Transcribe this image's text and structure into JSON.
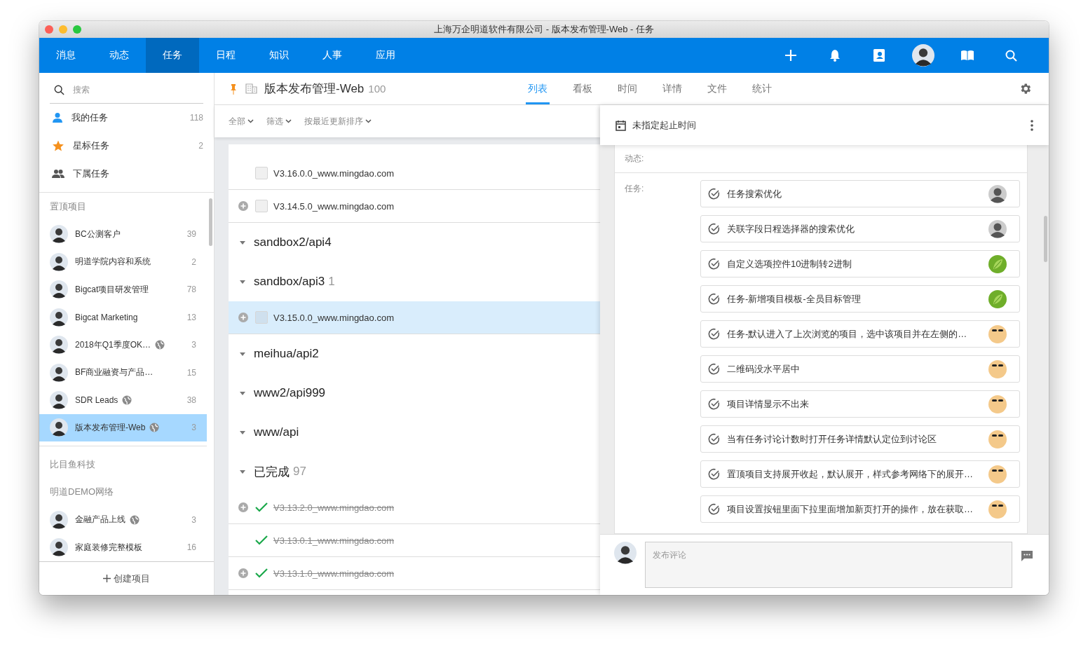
{
  "window": {
    "title": "上海万企明道软件有限公司 - 版本发布管理-Web - 任务"
  },
  "nav": {
    "tabs": [
      {
        "label": "消息",
        "selected": false
      },
      {
        "label": "动态",
        "selected": false
      },
      {
        "label": "任务",
        "selected": true
      },
      {
        "label": "日程",
        "selected": false
      },
      {
        "label": "知识",
        "selected": false
      },
      {
        "label": "人事",
        "selected": false
      },
      {
        "label": "应用",
        "selected": false
      }
    ]
  },
  "sidebar": {
    "search": {
      "placeholder": "搜索"
    },
    "items": [
      {
        "kind": "person",
        "label": "我的任务",
        "count": "118"
      },
      {
        "kind": "star",
        "label": "星标任务",
        "count": "2"
      },
      {
        "kind": "people",
        "label": "下属任务"
      }
    ],
    "pinned_header": "置顶项目",
    "pinned": [
      {
        "label": "BC公测客户",
        "count": "39",
        "public": false,
        "selected": false
      },
      {
        "label": "明道学院内容和系统",
        "count": "2",
        "public": false,
        "selected": false
      },
      {
        "label": "Bigcat项目研发管理",
        "count": "78",
        "public": false,
        "selected": false
      },
      {
        "label": "Bigcat Marketing",
        "count": "13",
        "public": false,
        "selected": false
      },
      {
        "label": "2018年Q1季度OK…",
        "count": "3",
        "public": true,
        "selected": false
      },
      {
        "label": "BF商业融资与产品…",
        "count": "15",
        "public": false,
        "selected": false
      },
      {
        "label": "SDR Leads",
        "count": "38",
        "public": true,
        "selected": false
      },
      {
        "label": "版本发布管理-Web",
        "count": "3",
        "public": true,
        "selected": true
      }
    ],
    "groups": [
      {
        "name": "比目鱼科技"
      },
      {
        "name": "明道DEMO网络",
        "projects": [
          {
            "label": "金融产品上线",
            "count": "3",
            "public": true,
            "selected": false
          },
          {
            "label": "家庭装修完整模板",
            "count": "16",
            "public": false,
            "selected": false
          }
        ]
      }
    ],
    "create_button": "创建项目"
  },
  "project": {
    "pinned": true,
    "name": "版本发布管理-Web",
    "count": "100",
    "views": [
      {
        "label": "列表",
        "selected": true
      },
      {
        "label": "看板",
        "selected": false
      },
      {
        "label": "时间",
        "selected": false
      },
      {
        "label": "详情",
        "selected": false
      },
      {
        "label": "文件",
        "selected": false
      },
      {
        "label": "统计",
        "selected": false
      }
    ]
  },
  "filters": [
    "全部",
    "筛选",
    "按最近更新排序"
  ],
  "task_list": [
    {
      "kind": "task",
      "label": "V3.16.0.0_www.mingdao.com",
      "subtasks": false,
      "done": false,
      "selected": false
    },
    {
      "kind": "task",
      "label": "V3.14.5.0_www.mingdao.com",
      "subtasks": true,
      "done": false,
      "selected": false
    },
    {
      "kind": "group",
      "label": "sandbox2/api4"
    },
    {
      "kind": "group",
      "label": "sandbox/api3",
      "count": "1"
    },
    {
      "kind": "task",
      "label": "V3.15.0.0_www.mingdao.com",
      "subtasks": true,
      "done": false,
      "selected": true
    },
    {
      "kind": "group",
      "label": "meihua/api2"
    },
    {
      "kind": "group",
      "label": "www2/api999"
    },
    {
      "kind": "group",
      "label": "www/api"
    },
    {
      "kind": "group",
      "label": "已完成",
      "count": "97"
    },
    {
      "kind": "task",
      "label": "V3.13.2.0_www.mingdao.com",
      "subtasks": true,
      "done": true,
      "selected": false
    },
    {
      "kind": "task",
      "label": "V3.13.0.1_www.mingdao.com",
      "subtasks": false,
      "done": true,
      "selected": false
    },
    {
      "kind": "task",
      "label": "V3.13.1.0_www.mingdao.com",
      "subtasks": true,
      "done": true,
      "selected": false
    }
  ],
  "detail": {
    "date": "未指定起止时间",
    "activity_label": "动态:",
    "tasks_label": "任务:",
    "tasks": [
      {
        "label": "任务搜索优化",
        "kind": "person"
      },
      {
        "label": "关联字段日程选择器的搜索优化",
        "kind": "person"
      },
      {
        "label": "自定义选项控件10进制转2进制",
        "kind": "leaf"
      },
      {
        "label": "任务-新增项目模板-全员目标管理",
        "kind": "leaf"
      },
      {
        "label": "任务-默认进入了上次浏览的项目，选中该项目并在左侧的…",
        "kind": "cartoon"
      },
      {
        "label": "二维码没水平居中",
        "kind": "cartoon"
      },
      {
        "label": "项目详情显示不出来",
        "kind": "cartoon"
      },
      {
        "label": "当有任务讨论计数时打开任务详情默认定位到讨论区",
        "kind": "cartoon"
      },
      {
        "label": "置顶项目支持展开收起，默认展开，样式参考网络下的展开…",
        "kind": "cartoon"
      },
      {
        "label": "项目设置按钮里面下拉里面增加新页打开的操作，放在获取…",
        "kind": "cartoon"
      }
    ],
    "comment": {
      "placeholder": "发布评论"
    }
  }
}
